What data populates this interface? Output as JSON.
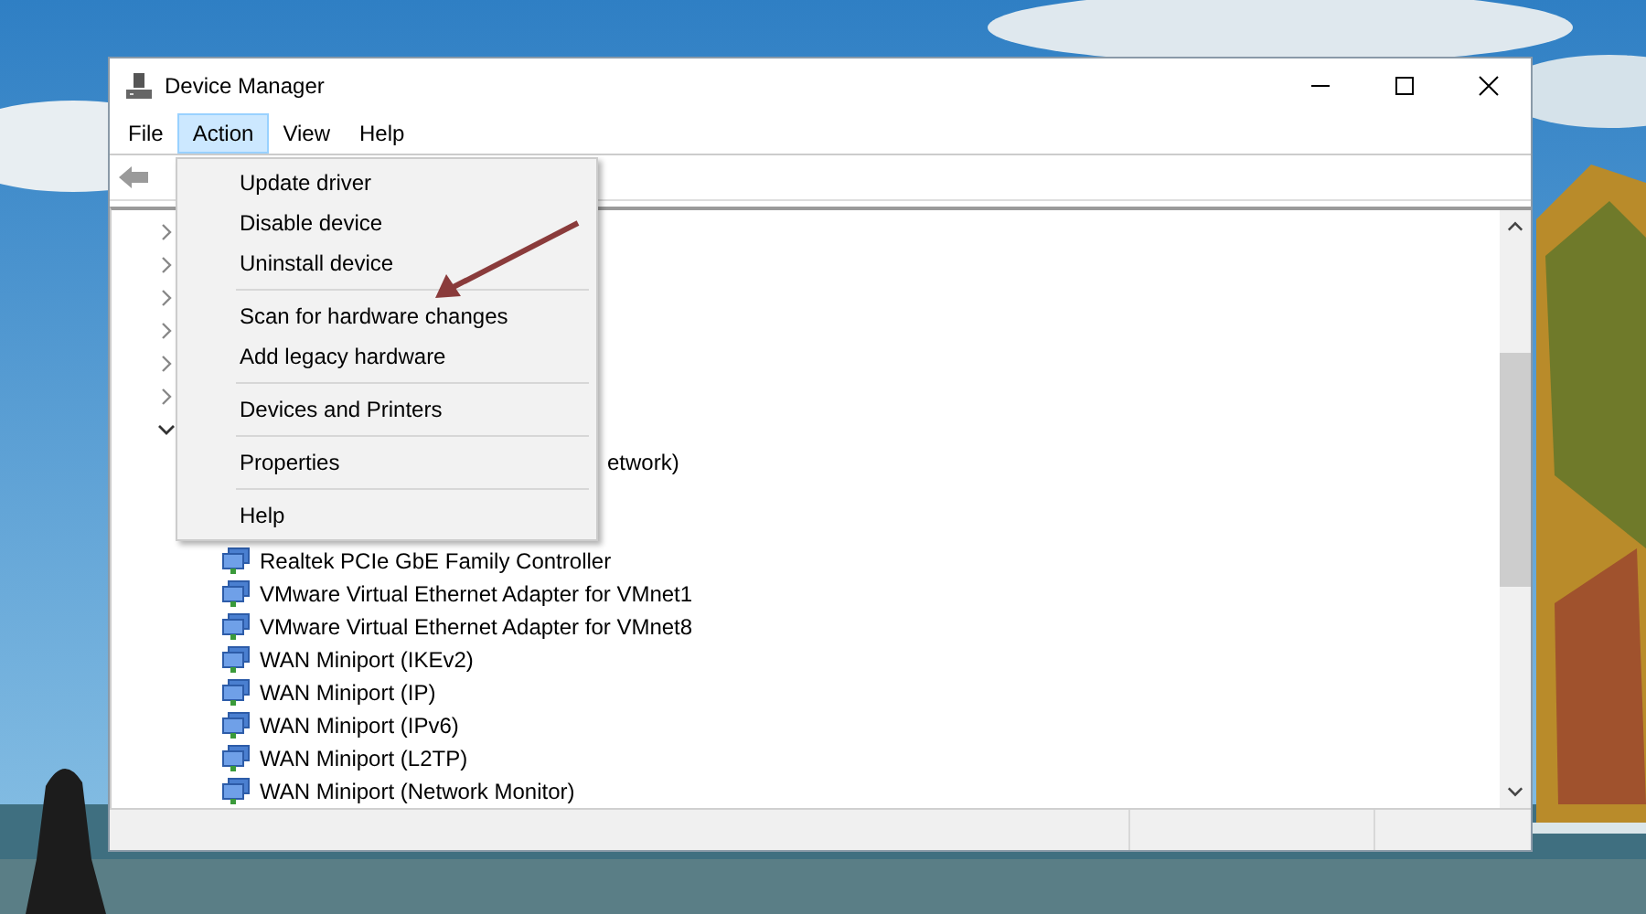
{
  "window": {
    "title": "Device Manager"
  },
  "menu_bar": [
    {
      "label": "File",
      "selected": false
    },
    {
      "label": "Action",
      "selected": true
    },
    {
      "label": "View",
      "selected": false
    },
    {
      "label": "Help",
      "selected": false
    }
  ],
  "action_menu": {
    "items": [
      {
        "kind": "item",
        "label": "Update driver"
      },
      {
        "kind": "item",
        "label": "Disable device"
      },
      {
        "kind": "item",
        "label": "Uninstall device"
      },
      {
        "kind": "separator"
      },
      {
        "kind": "item",
        "label": "Scan for hardware changes"
      },
      {
        "kind": "item",
        "label": "Add legacy hardware"
      },
      {
        "kind": "separator"
      },
      {
        "kind": "item",
        "label": "Devices and Printers"
      },
      {
        "kind": "separator"
      },
      {
        "kind": "item",
        "label": "Properties"
      },
      {
        "kind": "separator"
      },
      {
        "kind": "item",
        "label": "Help"
      }
    ]
  },
  "tree": {
    "nodes": [
      {
        "expanded": false
      },
      {
        "expanded": false
      },
      {
        "expanded": false
      },
      {
        "expanded": false
      },
      {
        "expanded": false
      },
      {
        "expanded": false
      },
      {
        "expanded": true,
        "children": [
          {
            "kind": "clipped",
            "label": "etwork)"
          },
          {
            "kind": "device",
            "label": "Realtek PCIe GbE Family Controller"
          },
          {
            "kind": "device",
            "label": "VMware Virtual Ethernet Adapter for VMnet1"
          },
          {
            "kind": "device",
            "label": "VMware Virtual Ethernet Adapter for VMnet8"
          },
          {
            "kind": "device",
            "label": "WAN Miniport (IKEv2)"
          },
          {
            "kind": "device",
            "label": "WAN Miniport (IP)"
          },
          {
            "kind": "device",
            "label": "WAN Miniport (IPv6)"
          },
          {
            "kind": "device",
            "label": "WAN Miniport (L2TP)"
          },
          {
            "kind": "device",
            "label": "WAN Miniport (Network Monitor)"
          }
        ]
      }
    ]
  }
}
